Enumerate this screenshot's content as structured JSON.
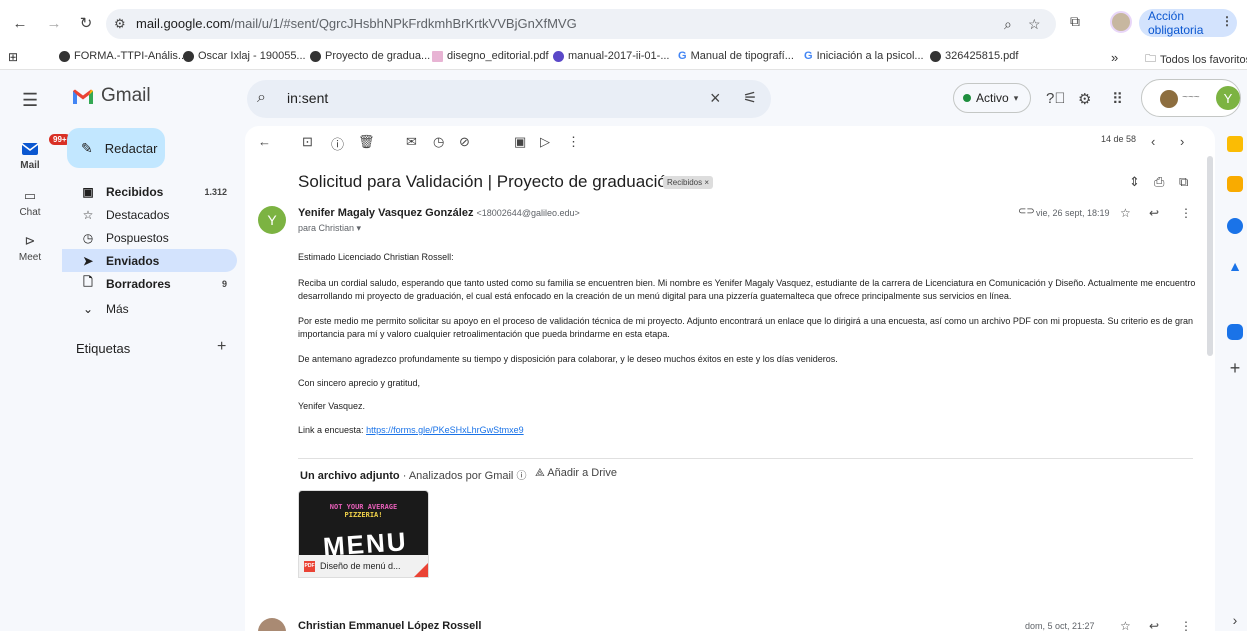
{
  "browser": {
    "url_host": "mail.google.com",
    "url_path": "/mail/u/1/#sent/QgrcJHsbhNPkFrdkmhBrKrtkVVBjGnXfMVG",
    "action_button": "Acción obligatoria",
    "bookmarks": [
      "FORMA.-TTPI-Anális...",
      "Oscar Ixlaj - 190055...",
      "Proyecto de gradua...",
      "disegno_editorial.pdf",
      "manual-2017-ii-01-...",
      "Manual de tipografí...",
      "Iniciación a la psicol...",
      "326425815.pdf"
    ],
    "bookmarks_overflow": "»",
    "all_bookmarks": "Todos los favoritos"
  },
  "gmail": {
    "app_name": "Gmail",
    "search_value": "in:sent",
    "status": "Activo",
    "account_initial": "Y"
  },
  "rail": {
    "mail_label": "Mail",
    "mail_badge": "99+",
    "chat_label": "Chat",
    "meet_label": "Meet"
  },
  "sidebar": {
    "compose": "Redactar",
    "items": [
      {
        "label": "Recibidos",
        "count": "1.312"
      },
      {
        "label": "Destacados",
        "count": ""
      },
      {
        "label": "Pospuestos",
        "count": ""
      },
      {
        "label": "Enviados",
        "count": ""
      },
      {
        "label": "Borradores",
        "count": "9"
      },
      {
        "label": "Más",
        "count": ""
      }
    ],
    "labels_heading": "Etiquetas"
  },
  "email": {
    "pager": "14 de 58",
    "subject": "Solicitud para Validación | Proyecto de graduación",
    "chip": "Recibidos ×",
    "sender_name": "Yenifer Magaly Vasquez González",
    "sender_email": "<18002644@galileo.edu>",
    "to": "para Christian ▾",
    "sender_initial": "Y",
    "date": "vie, 26 sept, 18:19",
    "body": [
      "Estimado Licenciado Christian Rossell:",
      "Reciba un cordial saludo, esperando que tanto usted como su familia se encuentren bien. Mi nombre es Yenifer Magaly Vasquez, estudiante de la carrera de Licenciatura en Comunicación y Diseño. Actualmente me encuentro desarrollando mi proyecto de graduación, el cual está enfocado en la creación de un menú digital para una pizzería guatemalteca que ofrece principalmente sus servicios en línea.",
      "Por este medio me permito solicitar su apoyo en el proceso de validación técnica de mi proyecto. Adjunto encontrará un enlace que lo dirigirá a una encuesta, así como un archivo PDF con mi propuesta. Su criterio es de gran importancia para mí y valoro cualquier retroalimentación que pueda brindarme en esta etapa.",
      "De antemano agradezco profundamente su tiempo y disposición para colaborar, y le deseo muchos éxitos en este y los días venideros.",
      "Con sincero aprecio y gratitud,",
      "Yenifer Vasquez."
    ],
    "link_label": "Link a encuesta:",
    "link_url": "https://forms.gle/PKeSHxLhrGwStmxe9",
    "attachment_heading": "Un archivo adjunto",
    "attachment_scan": "Analizados por Gmail",
    "add_to_drive": "Añadir a Drive",
    "thumb_line1": "NOT YOUR AVERAGE",
    "thumb_line2": "PIZZERIA!",
    "thumb_big": "MENU",
    "attachment_name": "Diseño de menú d...",
    "next_sender": "Christian Emmanuel López Rossell",
    "next_date": "dom, 5 oct, 21:27"
  },
  "colors": {
    "compose_bg": "#c2e7ff",
    "active_nav": "#d3e3fd",
    "status_green": "#1e8e3e",
    "avatar_green": "#7cb342",
    "badge_red": "#d93025"
  }
}
